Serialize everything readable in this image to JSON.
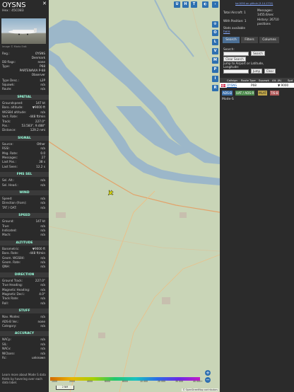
{
  "aircraft": {
    "callsign": "OYSNS",
    "hex_label": "Hex :",
    "hex": "45C083",
    "image_credit": "Image © Mario Erdt"
  },
  "info_rows": [
    {
      "k": "Reg.:",
      "v": "OYSNS"
    },
    {
      "k": "",
      "v": "Denmark"
    },
    {
      "k": "DB flags:",
      "v": "none"
    },
    {
      "k": "Type:",
      "v": "P68"
    },
    {
      "k": "",
      "v": "PARTENAVIA P-68"
    },
    {
      "k": "",
      "v": "Observer"
    },
    {
      "k": "Type Desc.:",
      "v": "L2P"
    },
    {
      "k": "Squawk:",
      "v": "n/a"
    },
    {
      "k": "Route:",
      "v": "n/a"
    }
  ],
  "sections": [
    {
      "title": "SPATIAL",
      "rows": [
        {
          "k": "Groundspeed:",
          "v": "147 kt"
        },
        {
          "k": "Baro. altitude:",
          "v": "▼9000 ft"
        },
        {
          "k": "WGS84 altitude:",
          "v": "n/a"
        },
        {
          "k": "Vert. Rate:",
          "v": "-448 ft/min"
        },
        {
          "k": "Track:",
          "v": "227.0°"
        },
        {
          "k": "Pos.:",
          "v": "53.583°, 9.488°"
        },
        {
          "k": "Distance:",
          "v": "129.2 nmi"
        }
      ]
    },
    {
      "title": "SIGNAL",
      "rows": [
        {
          "k": "Source:",
          "v": "Other"
        },
        {
          "k": "RSSI:",
          "v": "n/a"
        },
        {
          "k": "Msg. Rate:",
          "v": "0.0"
        },
        {
          "k": "Messages:",
          "v": "27"
        },
        {
          "k": "Last Pos.:",
          "v": "38 s"
        },
        {
          "k": "Last Seen:",
          "v": "12.2 s"
        }
      ]
    },
    {
      "title": "FMS SEL",
      "rows": [
        {
          "k": "Sel. Alt.:",
          "v": "n/a"
        },
        {
          "k": "Sel. Head.:",
          "v": "n/a"
        }
      ]
    },
    {
      "title": "WIND",
      "rows": [
        {
          "k": "Speed:",
          "v": "n/a"
        },
        {
          "k": "Direction (from):",
          "v": "n/a"
        },
        {
          "k": "TAT / OAT:",
          "v": "n/a"
        }
      ]
    },
    {
      "title": "SPEED",
      "rows": [
        {
          "k": "Ground:",
          "v": "147 kt"
        },
        {
          "k": "True:",
          "v": "n/a"
        },
        {
          "k": "Indicated:",
          "v": "n/a"
        },
        {
          "k": "Mach:",
          "v": "n/a"
        }
      ]
    },
    {
      "title": "ALTITUDE",
      "rows": [
        {
          "k": "Barometric:",
          "v": "▼9000 ft"
        },
        {
          "k": "Baro. Rate:",
          "v": "-448 ft/min"
        },
        {
          "k": "Geom. WGS84:",
          "v": "n/a"
        },
        {
          "k": "Geom. Rate:",
          "v": "n/a"
        },
        {
          "k": "QNH:",
          "v": "n/a"
        }
      ]
    },
    {
      "title": "DIRECTION",
      "rows": [
        {
          "k": "Ground Track:",
          "v": "227.0°"
        },
        {
          "k": "True Heading:",
          "v": "n/a"
        },
        {
          "k": "Magnetic Heading:",
          "v": "n/a"
        },
        {
          "k": "Magnetic Decl.:",
          "v": "4.0°"
        },
        {
          "k": "Track Rate:",
          "v": "n/a"
        },
        {
          "k": "Roll:",
          "v": "n/a"
        }
      ]
    },
    {
      "title": "STUFF",
      "rows": [
        {
          "k": "Nav. Modes:",
          "v": "n/a"
        },
        {
          "k": "ADS-B Ver.:",
          "v": "none"
        },
        {
          "k": "Category:",
          "v": "n/a"
        }
      ]
    },
    {
      "title": "ACCURACY",
      "rows": [
        {
          "k": "NACp:",
          "v": "n/a"
        },
        {
          "k": "SIL:",
          "v": "n/a"
        },
        {
          "k": "NACv:",
          "v": "n/a"
        },
        {
          "k": "NICbaro:",
          "v": "n/a"
        },
        {
          "k": "Rc:",
          "v": "unknown"
        }
      ]
    }
  ],
  "footer_text": "Learn more about Mode S data fields by hovering over each data label.",
  "map": {
    "buttons_top": [
      "U",
      "H",
      "T"
    ],
    "buttons_side": [
      "O",
      "L",
      "V",
      "M",
      "P",
      "I",
      "R"
    ],
    "colorbar_labels": [
      "1000",
      "2000",
      "4000",
      "6000",
      "8000",
      "10 000",
      "20 000",
      "30 000",
      "40 000+"
    ],
    "scale": "2 NM",
    "attribution": "© OpenStreetMap contributors",
    "zoom_in": "+",
    "zoom_out": "−"
  },
  "right": {
    "version_link": "tar1090 on github (3.14.1732)",
    "total_label": "Total Aircraft: 1",
    "messages_label": "Messages:",
    "messages_value": "1455.6/sec",
    "with_pos_label": "With Position: 1",
    "history_label": "History: 26710",
    "history_unit": "positions",
    "stats": "Stats available",
    "stats_link": "here",
    "tabs": [
      "Search",
      "Filters",
      "Columns"
    ],
    "search_label": "Search:",
    "search_btn": "Search",
    "clear_btn": "Clear Search",
    "jump_label": "Jump to Airport or Latitude, Longitude:",
    "jump_btn": "Jump",
    "clear2_btn": "Clear",
    "table_headers": [
      "Callsign",
      "Route",
      "Type",
      "Squawk",
      "Alt. (ft)",
      "Spd"
    ],
    "table_row": {
      "callsign": "OYSNS",
      "type": "P68",
      "alt": "▼ 9000"
    },
    "tags": [
      "ADS-B",
      "UAT / ADS-R",
      "MLAT",
      "TIS-B"
    ],
    "mode_s": "Mode-S"
  },
  "colors": {
    "accent": "#2d6fb0",
    "section_text": "#9fd",
    "water": "#9cb7c9"
  }
}
